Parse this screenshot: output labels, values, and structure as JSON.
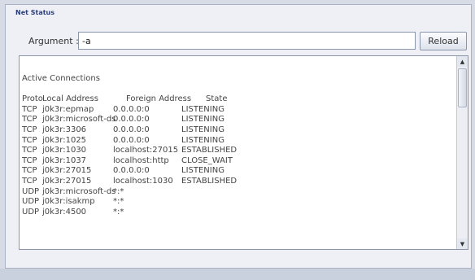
{
  "panel": {
    "title": "Net Status"
  },
  "argument": {
    "label": "Argument :",
    "value": "-a"
  },
  "reload_label": "Reload",
  "output": {
    "heading": "Active Connections",
    "columns": [
      "Proto",
      "Local Address",
      "Foreign Address",
      "State"
    ],
    "rows": [
      [
        "TCP",
        "j0k3r:epmap",
        "0.0.0.0:0",
        "LISTENING"
      ],
      [
        "TCP",
        "j0k3r:microsoft-ds",
        "0.0.0.0:0",
        "LISTENING"
      ],
      [
        "TCP",
        "j0k3r:3306",
        "0.0.0.0:0",
        "LISTENING"
      ],
      [
        "TCP",
        "j0k3r:1025",
        "0.0.0.0:0",
        "LISTENING"
      ],
      [
        "TCP",
        "j0k3r:1030",
        "localhost:27015",
        "ESTABLISHED"
      ],
      [
        "TCP",
        "j0k3r:1037",
        "localhost:http",
        "CLOSE_WAIT"
      ],
      [
        "TCP",
        "j0k3r:27015",
        "0.0.0.0:0",
        "LISTENING"
      ],
      [
        "TCP",
        "j0k3r:27015",
        "localhost:1030",
        "ESTABLISHED"
      ],
      [
        "UDP",
        "j0k3r:microsoft-ds",
        "*:*",
        ""
      ],
      [
        "UDP",
        "j0k3r:isakmp",
        "*:*",
        ""
      ],
      [
        "UDP",
        "j0k3r:4500",
        "*:*",
        ""
      ]
    ]
  },
  "scrollbar": {
    "up_icon": "triangle-up",
    "down_icon": "triangle-down"
  },
  "colors": {
    "title": "#2d3f7a",
    "panel_bg": "#eef0f5",
    "page_bg": "#d6dbe6"
  }
}
